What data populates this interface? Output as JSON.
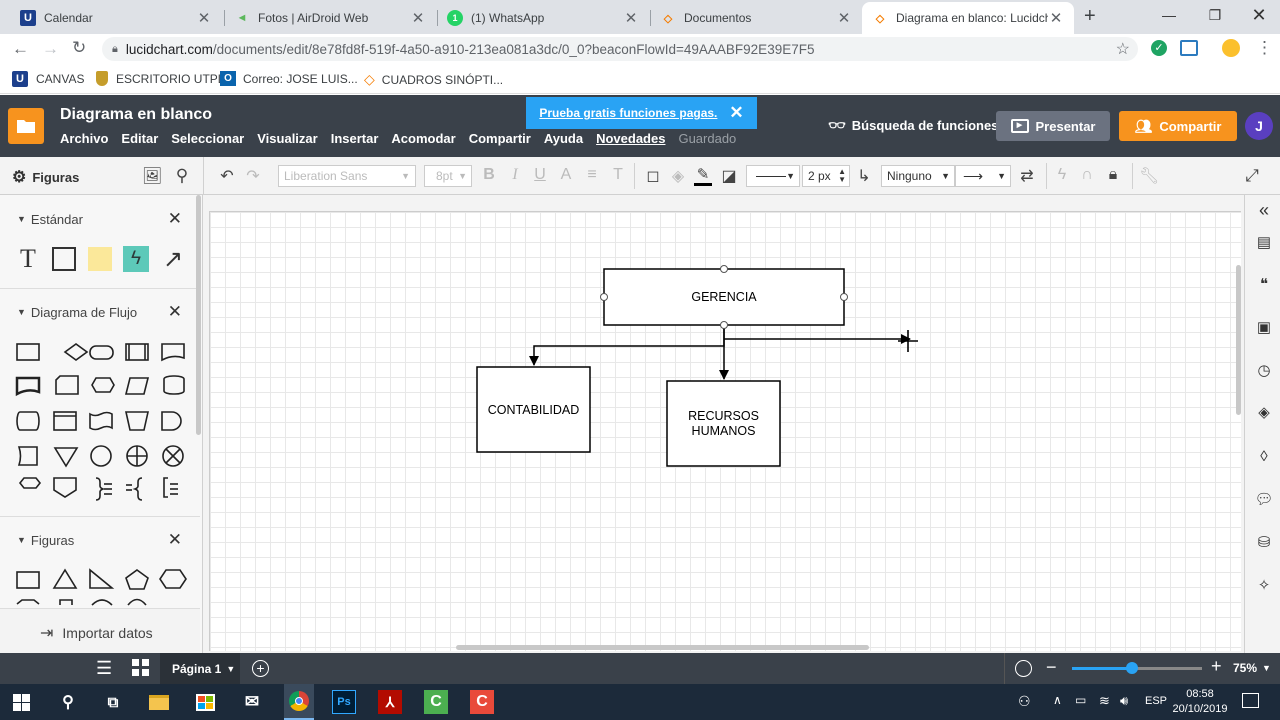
{
  "browser": {
    "tabs": [
      {
        "title": "Calendar",
        "favicon": "U",
        "favicon_color": "#1c3f8c"
      },
      {
        "title": "Fotos | AirDroid Web",
        "favicon": "◄",
        "favicon_color": "#5cb85c"
      },
      {
        "title": "(1) WhatsApp",
        "favicon": "1",
        "favicon_color": "#25d366"
      },
      {
        "title": "Documentos",
        "favicon": "◇",
        "favicon_color": "#f57c00"
      },
      {
        "title": "Diagrama en blanco: Lucidchart",
        "favicon": "◇",
        "favicon_color": "#f57c00"
      }
    ],
    "url_host": "lucidchart.com",
    "url_path": "/documents/edit/8e78fd8f-519f-4a50-a910-213ea081a3dc/0_0?beaconFlowId=49AAABF92E39E7F5",
    "bookmarks": [
      {
        "label": "CANVAS"
      },
      {
        "label": "ESCRITORIO UTPL"
      },
      {
        "label": "Correo: JOSE LUIS..."
      },
      {
        "label": "CUADROS SINÓPTI..."
      }
    ]
  },
  "app": {
    "doc_title": "Diagrama en blanco",
    "menu": [
      "Archivo",
      "Editar",
      "Seleccionar",
      "Visualizar",
      "Insertar",
      "Acomodar",
      "Compartir",
      "Ayuda"
    ],
    "menu_news": "Novedades",
    "menu_saved": "Guardado",
    "promo": "Prueba gratis funciones pagas.",
    "feature_search": "Búsqueda de funciones",
    "present": "Presentar",
    "share": "Compartir",
    "avatar": "J",
    "accent": "#f7931e"
  },
  "toolbar": {
    "shapes_label": "Figuras",
    "font": "Liberation Sans",
    "font_size": "8pt",
    "line_width": "2 px",
    "endpoint": "Ninguno"
  },
  "panel": {
    "sections": [
      "Estándar",
      "Diagrama de Flujo",
      "Figuras"
    ],
    "import": "Importar datos"
  },
  "diagram": {
    "nodes": [
      {
        "label": "GERENCIA"
      },
      {
        "label": "CONTABILIDAD"
      },
      {
        "label_line1": "RECURSOS",
        "label_line2": "HUMANOS"
      }
    ]
  },
  "bottom": {
    "page": "Página 1",
    "zoom": "75%",
    "zoom_level": 0.46
  },
  "taskbar": {
    "lang": "ESP",
    "time": "08:58",
    "date": "20/10/2019"
  }
}
